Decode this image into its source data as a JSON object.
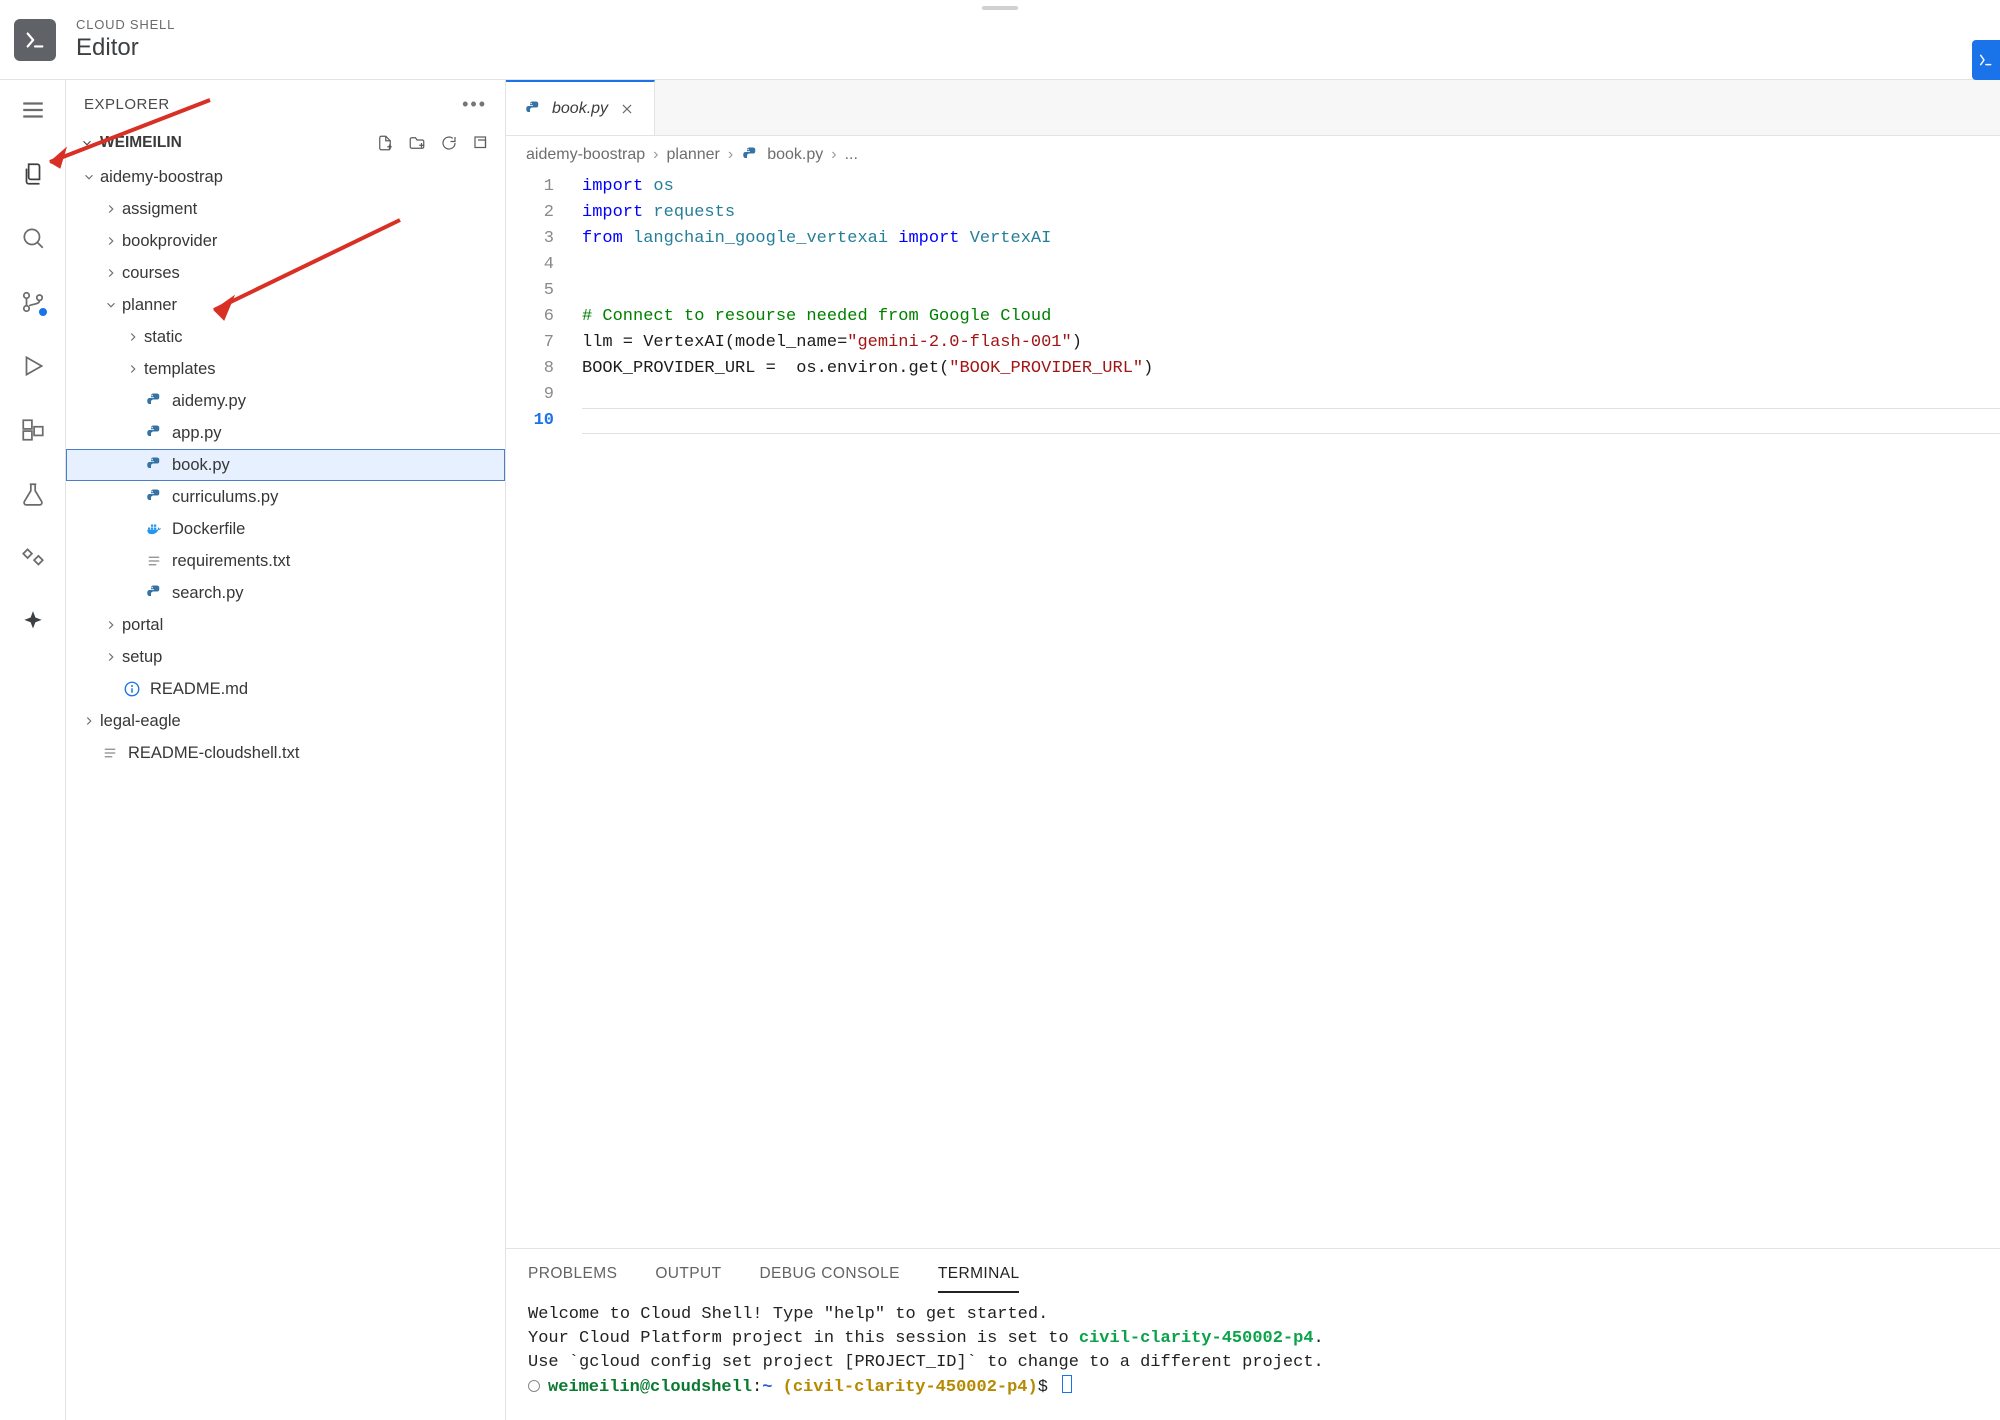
{
  "header": {
    "small": "CLOUD SHELL",
    "big": "Editor"
  },
  "sidebar": {
    "title": "EXPLORER",
    "root": "WEIMEILIN"
  },
  "tree": {
    "items": [
      {
        "depth": 0,
        "kind": "folder",
        "open": true,
        "name": "aidemy-boostrap",
        "label": "aidemy-boostrap"
      },
      {
        "depth": 1,
        "kind": "folder",
        "open": false,
        "name": "assigment",
        "label": "assigment"
      },
      {
        "depth": 1,
        "kind": "folder",
        "open": false,
        "name": "bookprovider",
        "label": "bookprovider"
      },
      {
        "depth": 1,
        "kind": "folder",
        "open": false,
        "name": "courses",
        "label": "courses"
      },
      {
        "depth": 1,
        "kind": "folder",
        "open": true,
        "name": "planner",
        "label": "planner"
      },
      {
        "depth": 2,
        "kind": "folder",
        "open": false,
        "name": "static",
        "label": "static"
      },
      {
        "depth": 2,
        "kind": "folder",
        "open": false,
        "name": "templates",
        "label": "templates"
      },
      {
        "depth": 2,
        "kind": "py",
        "name": "aidemy-py",
        "label": "aidemy.py"
      },
      {
        "depth": 2,
        "kind": "py",
        "name": "app-py",
        "label": "app.py"
      },
      {
        "depth": 2,
        "kind": "py",
        "name": "book-py",
        "label": "book.py",
        "selected": true
      },
      {
        "depth": 2,
        "kind": "py",
        "name": "curriculums-py",
        "label": "curriculums.py"
      },
      {
        "depth": 2,
        "kind": "docker",
        "name": "dockerfile",
        "label": "Dockerfile"
      },
      {
        "depth": 2,
        "kind": "txt",
        "name": "requirements-txt",
        "label": "requirements.txt"
      },
      {
        "depth": 2,
        "kind": "py",
        "name": "search-py",
        "label": "search.py"
      },
      {
        "depth": 1,
        "kind": "folder",
        "open": false,
        "name": "portal",
        "label": "portal"
      },
      {
        "depth": 1,
        "kind": "folder",
        "open": false,
        "name": "setup",
        "label": "setup"
      },
      {
        "depth": 1,
        "kind": "info",
        "name": "readme-md",
        "label": "README.md"
      },
      {
        "depth": 0,
        "kind": "folder",
        "open": false,
        "name": "legal-eagle",
        "label": "legal-eagle"
      },
      {
        "depth": 0,
        "kind": "txt",
        "name": "readme-cloudshell",
        "label": "README-cloudshell.txt"
      }
    ]
  },
  "tab": {
    "label": "book.py"
  },
  "breadcrumb": {
    "p0": "aidemy-boostrap",
    "p1": "planner",
    "p2": "book.py",
    "p3": "..."
  },
  "code": {
    "lines": [
      {
        "n": "1",
        "pre": "",
        "tokens": [
          {
            "t": "kw",
            "v": "import"
          },
          {
            "t": "sp",
            "v": " "
          },
          {
            "t": "mod",
            "v": "os"
          }
        ]
      },
      {
        "n": "2",
        "pre": "",
        "tokens": [
          {
            "t": "kw",
            "v": "import"
          },
          {
            "t": "sp",
            "v": " "
          },
          {
            "t": "mod",
            "v": "requests"
          }
        ]
      },
      {
        "n": "3",
        "pre": "",
        "tokens": [
          {
            "t": "kw",
            "v": "from"
          },
          {
            "t": "sp",
            "v": " "
          },
          {
            "t": "mod",
            "v": "langchain_google_vertexai"
          },
          {
            "t": "sp",
            "v": " "
          },
          {
            "t": "kw",
            "v": "import"
          },
          {
            "t": "sp",
            "v": " "
          },
          {
            "t": "mod",
            "v": "VertexAI"
          }
        ]
      },
      {
        "n": "4",
        "pre": "",
        "tokens": []
      },
      {
        "n": "5",
        "pre": "",
        "tokens": []
      },
      {
        "n": "6",
        "pre": "",
        "tokens": [
          {
            "t": "cm",
            "v": "# Connect to resourse needed from Google Cloud"
          }
        ]
      },
      {
        "n": "7",
        "pre": "",
        "tokens": [
          {
            "t": "plain",
            "v": "llm = VertexAI"
          },
          {
            "t": "op",
            "v": "("
          },
          {
            "t": "plain",
            "v": "model_name"
          },
          {
            "t": "op",
            "v": "="
          },
          {
            "t": "str",
            "v": "\"gemini-2.0-flash-001\""
          },
          {
            "t": "op",
            "v": ")"
          }
        ]
      },
      {
        "n": "8",
        "pre": "",
        "tokens": [
          {
            "t": "plain",
            "v": "BOOK_PROVIDER_URL =  os.environ.get"
          },
          {
            "t": "op",
            "v": "("
          },
          {
            "t": "str",
            "v": "\"BOOK_PROVIDER_URL\""
          },
          {
            "t": "op",
            "v": ")"
          }
        ]
      },
      {
        "n": "9",
        "pre": "",
        "tokens": []
      },
      {
        "n": "10",
        "pre": "",
        "tokens": [],
        "current": true
      }
    ]
  },
  "panel": {
    "tabs": {
      "problems": "PROBLEMS",
      "output": "OUTPUT",
      "debug": "DEBUG CONSOLE",
      "terminal": "TERMINAL"
    }
  },
  "terminal": {
    "l1": "Welcome to Cloud Shell! Type \"help\" to get started.",
    "l2a": "Your Cloud Platform project in this session is set to ",
    "l2b": "civil-clarity-450002-p4",
    "l2c": ".",
    "l3": "Use `gcloud config set project [PROJECT_ID]` to change to a different project.",
    "prompt_user": "weimeilin@cloudshell",
    "prompt_sep": ":",
    "prompt_path": "~",
    "prompt_ctx": "(civil-clarity-450002-p4)",
    "prompt_dollar": "$"
  }
}
